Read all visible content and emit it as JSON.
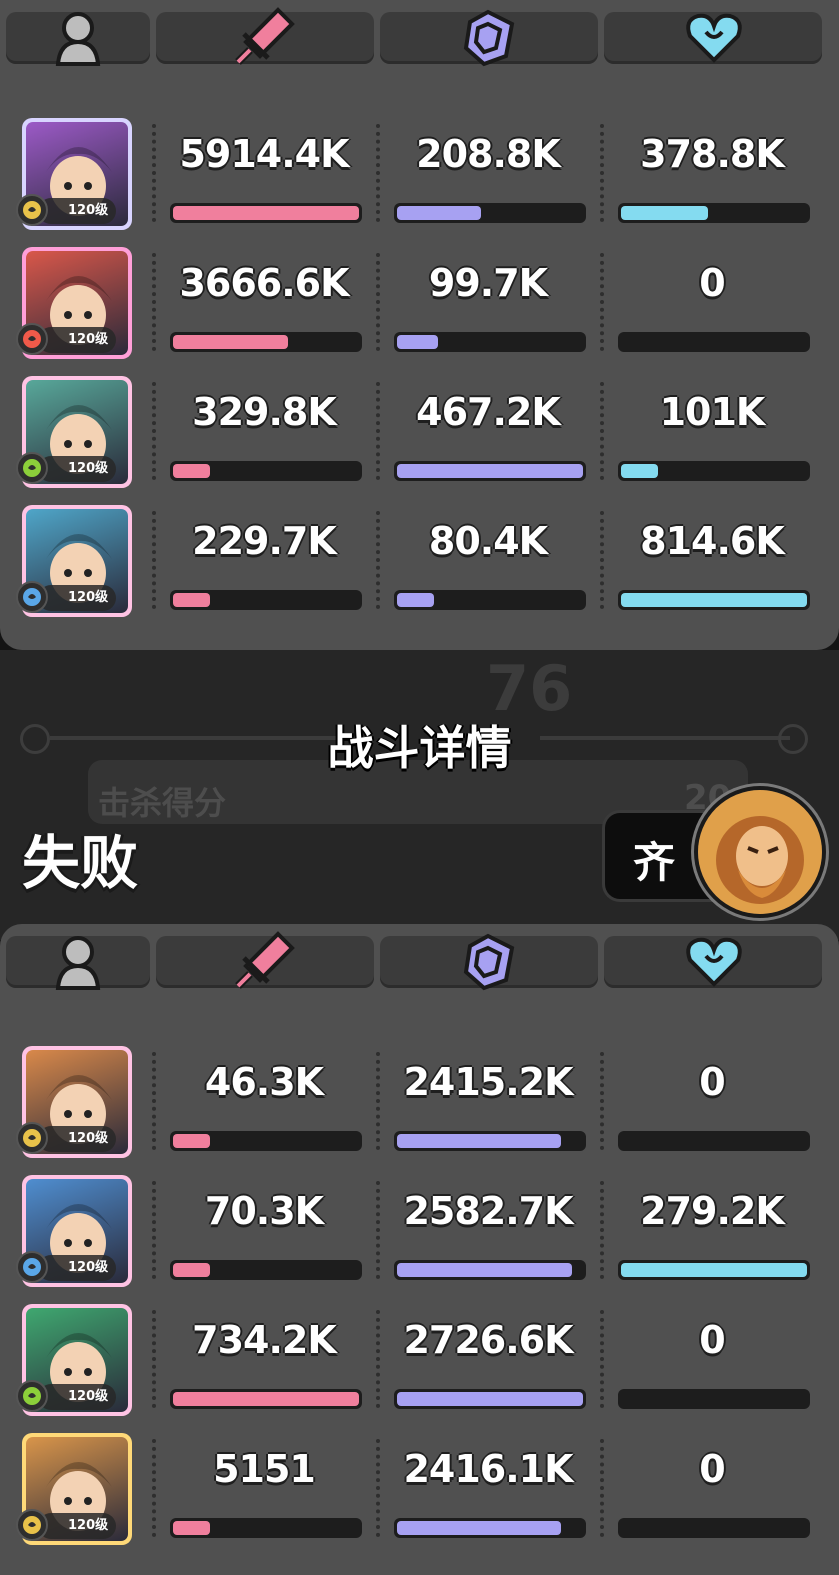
{
  "colors": {
    "atk": "#f07f9d",
    "def": "#a7a1f2",
    "heal": "#84dbf0"
  },
  "header_icons": [
    "person-icon",
    "sword-icon",
    "shield-icon",
    "heart-icon"
  ],
  "team_top": [
    {
      "level": "120级",
      "element": "earth",
      "atk": "5914.4K",
      "def": "208.8K",
      "heal": "378.8K",
      "atk_fill": 1.0,
      "def_fill": 0.45,
      "heal_fill": 0.47,
      "bg": "#9c5ac7",
      "frame": "#d8d4ff"
    },
    {
      "level": "120级",
      "element": "fire",
      "atk": "3666.6K",
      "def": "99.7K",
      "heal": "0",
      "atk_fill": 0.62,
      "def_fill": 0.22,
      "heal_fill": 0.0,
      "bg": "#d9574a",
      "frame": "#ff9fd8"
    },
    {
      "level": "120级",
      "element": "wind",
      "atk": "329.8K",
      "def": "467.2K",
      "heal": "101K",
      "atk_fill": 0.2,
      "def_fill": 1.0,
      "heal_fill": 0.2,
      "bg": "#58a89a",
      "frame": "#ffc3e4"
    },
    {
      "level": "120级",
      "element": "water",
      "atk": "229.7K",
      "def": "80.4K",
      "heal": "814.6K",
      "atk_fill": 0.2,
      "def_fill": 0.2,
      "heal_fill": 1.0,
      "bg": "#4fa6c9",
      "frame": "#ffc3e4"
    }
  ],
  "middle": {
    "title": "战斗详情",
    "kill_score_label": "击杀得分",
    "kill_score_value": "20",
    "bg_number": "76",
    "result": "失败",
    "player_name": "齐"
  },
  "team_bottom": [
    {
      "level": "120级",
      "element": "earth",
      "atk": "46.3K",
      "def": "2415.2K",
      "heal": "0",
      "atk_fill": 0.2,
      "def_fill": 0.88,
      "heal_fill": 0.0,
      "bg": "#d9894a",
      "frame": "#ffc3e4"
    },
    {
      "level": "120级",
      "element": "water",
      "atk": "70.3K",
      "def": "2582.7K",
      "heal": "279.2K",
      "atk_fill": 0.2,
      "def_fill": 0.94,
      "heal_fill": 1.0,
      "bg": "#4f8ed0",
      "frame": "#ffc3e4"
    },
    {
      "level": "120级",
      "element": "wind",
      "atk": "734.2K",
      "def": "2726.6K",
      "heal": "0",
      "atk_fill": 1.0,
      "def_fill": 1.0,
      "heal_fill": 0.0,
      "bg": "#3fa870",
      "frame": "#ffc3e4"
    },
    {
      "level": "120级",
      "element": "earth",
      "atk": "5151",
      "def": "2416.1K",
      "heal": "0",
      "atk_fill": 0.2,
      "def_fill": 0.88,
      "heal_fill": 0.0,
      "bg": "#d9954a",
      "frame": "#ffd978"
    }
  ]
}
